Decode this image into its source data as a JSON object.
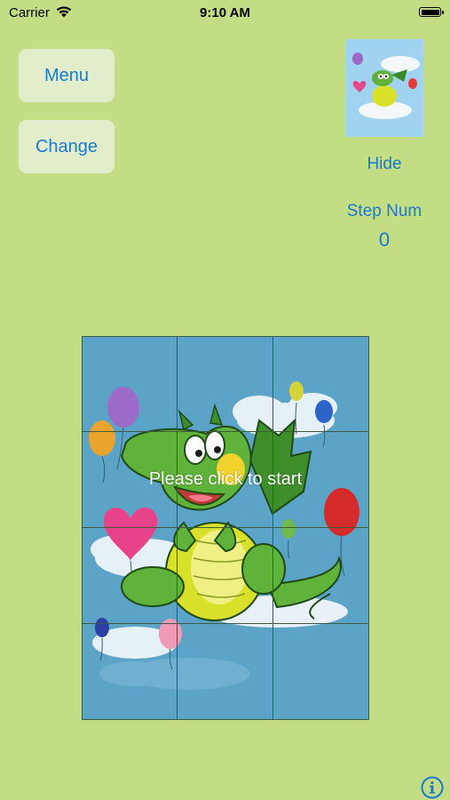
{
  "status_bar": {
    "carrier": "Carrier",
    "time": "9:10 AM"
  },
  "buttons": {
    "menu": "Menu",
    "change": "Change"
  },
  "preview": {
    "hide_label": "Hide"
  },
  "steps": {
    "label": "Step Num",
    "value": "0"
  },
  "board": {
    "message": "Please click to start",
    "rows": 4,
    "columns": 3
  },
  "colors": {
    "background": "#c3dd85",
    "button_bg": "#e1edcb",
    "accent": "#1c79d3",
    "board_bg": "#5ca4c7"
  },
  "icons": [
    "wifi-icon",
    "battery-icon",
    "info-icon"
  ]
}
